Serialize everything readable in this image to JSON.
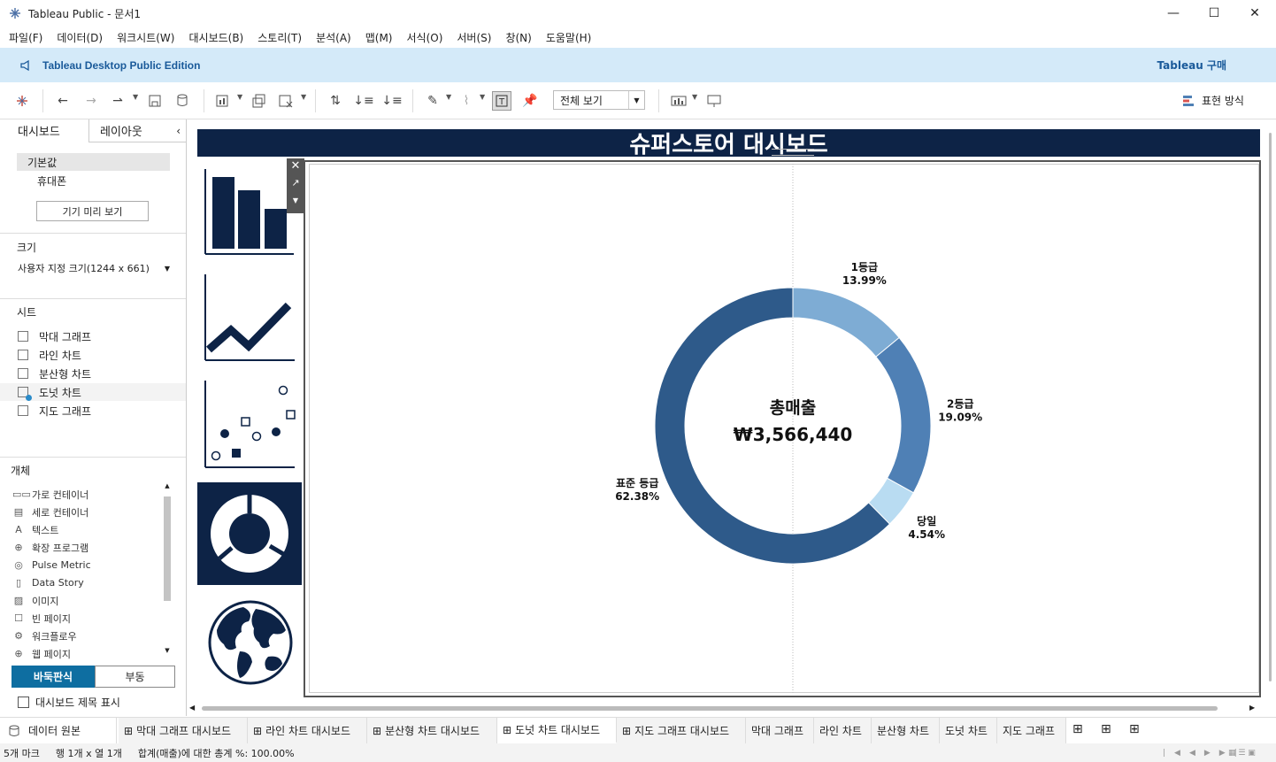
{
  "window": {
    "title": "Tableau Public - 문서1",
    "min": "—",
    "max": "☐",
    "close": "✕"
  },
  "menu": [
    "파일(F)",
    "데이터(D)",
    "워크시트(W)",
    "대시보드(B)",
    "스토리(T)",
    "분석(A)",
    "맵(M)",
    "서식(O)",
    "서버(S)",
    "창(N)",
    "도움말(H)"
  ],
  "banner": {
    "title": "Tableau Desktop Public Edition",
    "buy": "Tableau 구매"
  },
  "toolbar": {
    "view_select": "전체 보기",
    "show_me": "표현 방식"
  },
  "left_panel": {
    "tabs": [
      "대시보드",
      "레이아웃"
    ],
    "devices": [
      "기본값",
      "휴대폰"
    ],
    "device_preview": "기기 미리 보기",
    "size_title": "크기",
    "size_value": "사용자 지정 크기(1244 x 661)",
    "sheets_title": "시트",
    "sheets": [
      "막대 그래프",
      "라인 차트",
      "분산형 차트",
      "도넛 차트",
      "지도 그래프"
    ],
    "objects_title": "개체",
    "objects": [
      "가로 컨테이너",
      "세로 컨테이너",
      "텍스트",
      "확장 프로그램",
      "Pulse Metric",
      "Data Story",
      "이미지",
      "빈 페이지",
      "워크플로우",
      "웹 페이지"
    ],
    "object_icons": [
      "▭▭",
      "▤",
      "A",
      "⊕",
      "◎",
      "▯",
      "▨",
      "☐",
      "⚙",
      "⊕"
    ],
    "tiled": "바둑판식",
    "floating": "부동",
    "show_title": "대시보드 제목 표시"
  },
  "dashboard": {
    "title": "슈퍼스토어 대시보드"
  },
  "chart_data": {
    "type": "pie",
    "center_label": "총매출",
    "center_value": "₩3,566,440",
    "slices": [
      {
        "name": "1등급",
        "label": "13.99%",
        "value": 13.99,
        "color": "#7eacd4"
      },
      {
        "name": "2등급",
        "label": "19.09%",
        "value": 19.09,
        "color": "#4f80b5"
      },
      {
        "name": "당일",
        "label": "4.54%",
        "value": 4.54,
        "color": "#b9dcf2"
      },
      {
        "name": "표준 등급",
        "label": "62.38%",
        "value": 62.38,
        "color": "#2e5a8a"
      }
    ]
  },
  "bottom_tabs": {
    "data_source": "데이터 원본",
    "tabs": [
      "막대 그래프 대시보드",
      "라인 차트 대시보드",
      "분산형 차트 대시보드",
      "도넛 차트 대시보드",
      "지도 그래프 대시보드",
      "막대 그래프",
      "라인 차트",
      "분산형 차트",
      "도넛 차트",
      "지도 그래프"
    ],
    "active_index": 3
  },
  "status": {
    "marks": "5개 마크",
    "rows_cols": "행 1개 x 열 1개",
    "sum": "합계(매출)에 대한 총계 %: 100.00%"
  },
  "colors": {
    "dash_title_bg": "#0d2346",
    "banner_bg": "#d4eaf9",
    "accent": "#0e6ea1"
  }
}
